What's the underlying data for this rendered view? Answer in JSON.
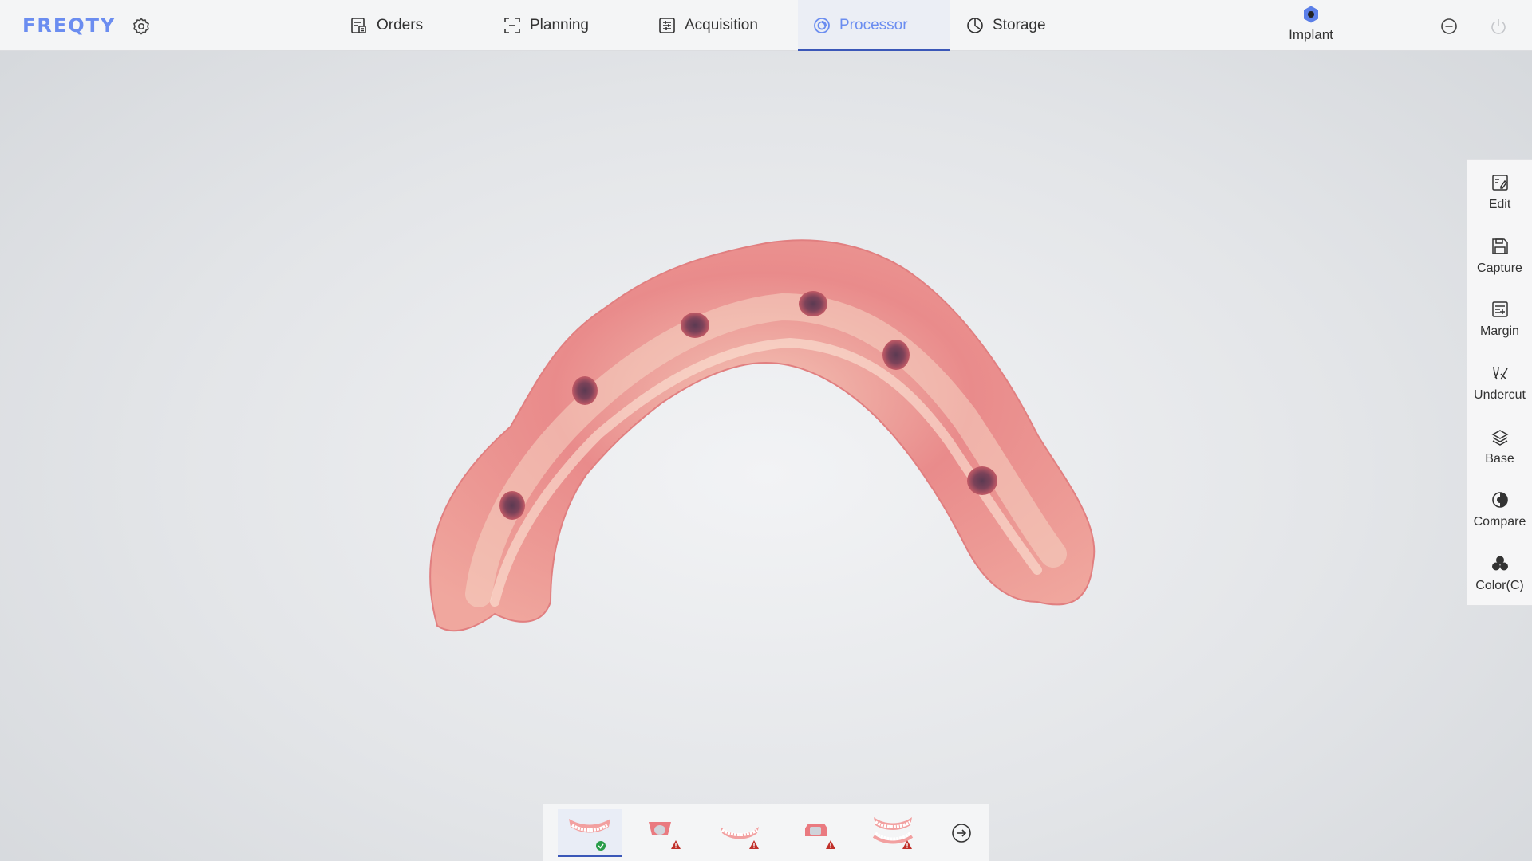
{
  "app": {
    "brand": "FREQTY"
  },
  "nav": {
    "tabs": [
      {
        "label": "Orders",
        "icon": "orders-icon"
      },
      {
        "label": "Planning",
        "icon": "planning-icon"
      },
      {
        "label": "Acquisition",
        "icon": "acquisition-icon"
      },
      {
        "label": "Processor",
        "icon": "processor-icon",
        "active": true
      },
      {
        "label": "Storage",
        "icon": "storage-icon"
      }
    ],
    "mode": {
      "label": "Implant",
      "icon": "implant-hex-icon"
    }
  },
  "toolbar": {
    "items": [
      {
        "label": "Edit",
        "icon": "edit-icon"
      },
      {
        "label": "Capture",
        "icon": "save-icon"
      },
      {
        "label": "Margin",
        "icon": "margin-icon"
      },
      {
        "label": "Undercut",
        "icon": "undercut-icon"
      },
      {
        "label": "Base",
        "icon": "layers-icon"
      },
      {
        "label": "Compare",
        "icon": "compare-icon"
      },
      {
        "label": "Color(C)",
        "icon": "color-icon"
      }
    ]
  },
  "thumbnails": [
    {
      "name": "lower-arch-thumb",
      "status": "ok"
    },
    {
      "name": "implant-scanbody-thumb",
      "status": "warning"
    },
    {
      "name": "upper-arch-thumb",
      "status": "warning"
    },
    {
      "name": "bite-thumb",
      "status": "warning"
    },
    {
      "name": "full-arch-thumb",
      "status": "warning"
    }
  ],
  "colors": {
    "accent": "#6b8df0",
    "active_underline": "#3a57b8",
    "ok": "#2a9d4a",
    "warning": "#c0302a",
    "gum": "#e98b8b"
  }
}
